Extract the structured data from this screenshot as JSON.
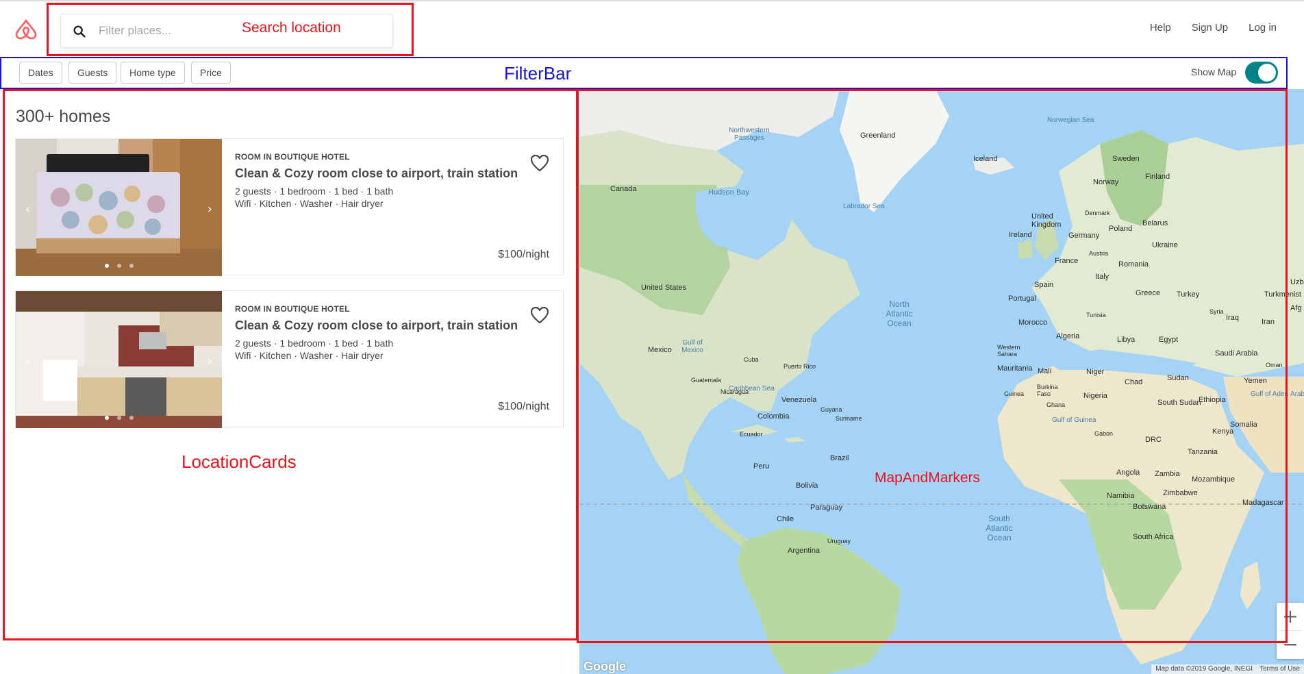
{
  "header": {
    "logo": "airbnb-logo",
    "search": {
      "placeholder": "Filter places..."
    },
    "nav": {
      "help": "Help",
      "signup": "Sign Up",
      "login": "Log in"
    }
  },
  "filters": {
    "buttons": [
      "Dates",
      "Guests",
      "Home type",
      "Price"
    ],
    "show_map_label": "Show Map",
    "show_map_on": true
  },
  "listings": {
    "title": "300+ homes",
    "cards": [
      {
        "type": "ROOM IN BOUTIQUE HOTEL",
        "title": "Clean & Cozy room close to airport, train station",
        "details": "2 guests · 1 bedroom · 1 bed · 1 bath",
        "amenities": "Wifi · Kitchen · Washer · Hair dryer",
        "price": "$100/night",
        "image": "bedroom-photo"
      },
      {
        "type": "ROOM IN BOUTIQUE HOTEL",
        "title": "Clean & Cozy room close to airport, train station",
        "details": "2 guests · 1 bedroom · 1 bed · 1 bath",
        "amenities": "Wifi · Kitchen · Washer · Hair dryer",
        "price": "$100/night",
        "image": "kitchen-photo"
      }
    ]
  },
  "map": {
    "labels": {
      "greenland": "Greenland",
      "iceland": "Iceland",
      "canada": "Canada",
      "hudson_bay": "Hudson Bay",
      "labrador_sea": "Labrador Sea",
      "norwegian_sea": "Norwegian Sea",
      "nw_passages": "Northwestern Passages",
      "sweden": "Sweden",
      "finland": "Finland",
      "norway": "Norway",
      "uk": "United Kingdom",
      "ireland": "Ireland",
      "denmark": "Denmark",
      "belarus": "Belarus",
      "poland": "Poland",
      "germany": "Germany",
      "ukraine": "Ukraine",
      "france": "France",
      "austria": "Austria",
      "romania": "Romania",
      "italy": "Italy",
      "spain": "Spain",
      "portugal": "Portugal",
      "greece": "Greece",
      "turkey": "Turkey",
      "turkmenistan": "Turkmenist",
      "united_states": "United States",
      "mexico": "Mexico",
      "gulf_mexico": "Gulf of Mexico",
      "cuba": "Cuba",
      "puerto_rico": "Puerto Rico",
      "caribbean": "Caribbean Sea",
      "guatemala": "Guatemala",
      "nicaragua": "Nicaragua",
      "venezuela": "Venezuela",
      "colombia": "Colombia",
      "guyana": "Guyana",
      "suriname": "Suriname",
      "ecuador": "Ecuador",
      "peru": "Peru",
      "brazil": "Brazil",
      "bolivia": "Bolivia",
      "paraguay": "Paraguay",
      "chile": "Chile",
      "argentina": "Argentina",
      "uruguay": "Uruguay",
      "north_atlantic": "North Atlantic Ocean",
      "south_atlantic": "South Atlantic Ocean",
      "morocco": "Morocco",
      "algeria": "Algeria",
      "tunisia": "Tunisia",
      "libya": "Libya",
      "egypt": "Egypt",
      "western_sahara": "Western Sahara",
      "mauritania": "Mauritania",
      "mali": "Mali",
      "niger": "Niger",
      "chad": "Chad",
      "sudan": "Sudan",
      "south_sudan": "South Sudan",
      "ethiopia": "Ethiopia",
      "somalia": "Somalia",
      "kenya": "Kenya",
      "nigeria": "Nigeria",
      "guinea": "Guinea",
      "burkina_faso": "Burkina Faso",
      "ghana": "Ghana",
      "gulf_guinea": "Gulf of Guinea",
      "gabon": "Gabon",
      "drc": "DRC",
      "tanzania": "Tanzania",
      "angola": "Angola",
      "zambia": "Zambia",
      "mozambique": "Mozambique",
      "namibia": "Namibia",
      "zimbabwe": "Zimbabwe",
      "botswana": "Botswana",
      "madagascar": "Madagascar",
      "south_africa": "South Africa",
      "saudi_arabia": "Saudi Arabia",
      "yemen": "Yemen",
      "oman": "Oman",
      "iraq": "Iraq",
      "iran": "Iran",
      "syria": "Syria",
      "gulf_aden": "Gulf of Aden",
      "arab": "Arab",
      "afg": "Afg",
      "uzb": "Uzb"
    },
    "zoom_in": "+",
    "zoom_out": "−",
    "google": "Google",
    "attribution": "Map data ©2019 Google, INEGI",
    "terms": "Terms of Use"
  },
  "annotations": {
    "search_location": "Search location",
    "filter_bar": "FilterBar",
    "location_cards": "LocationCards",
    "map_and_markers": "MapAndMarkers"
  }
}
